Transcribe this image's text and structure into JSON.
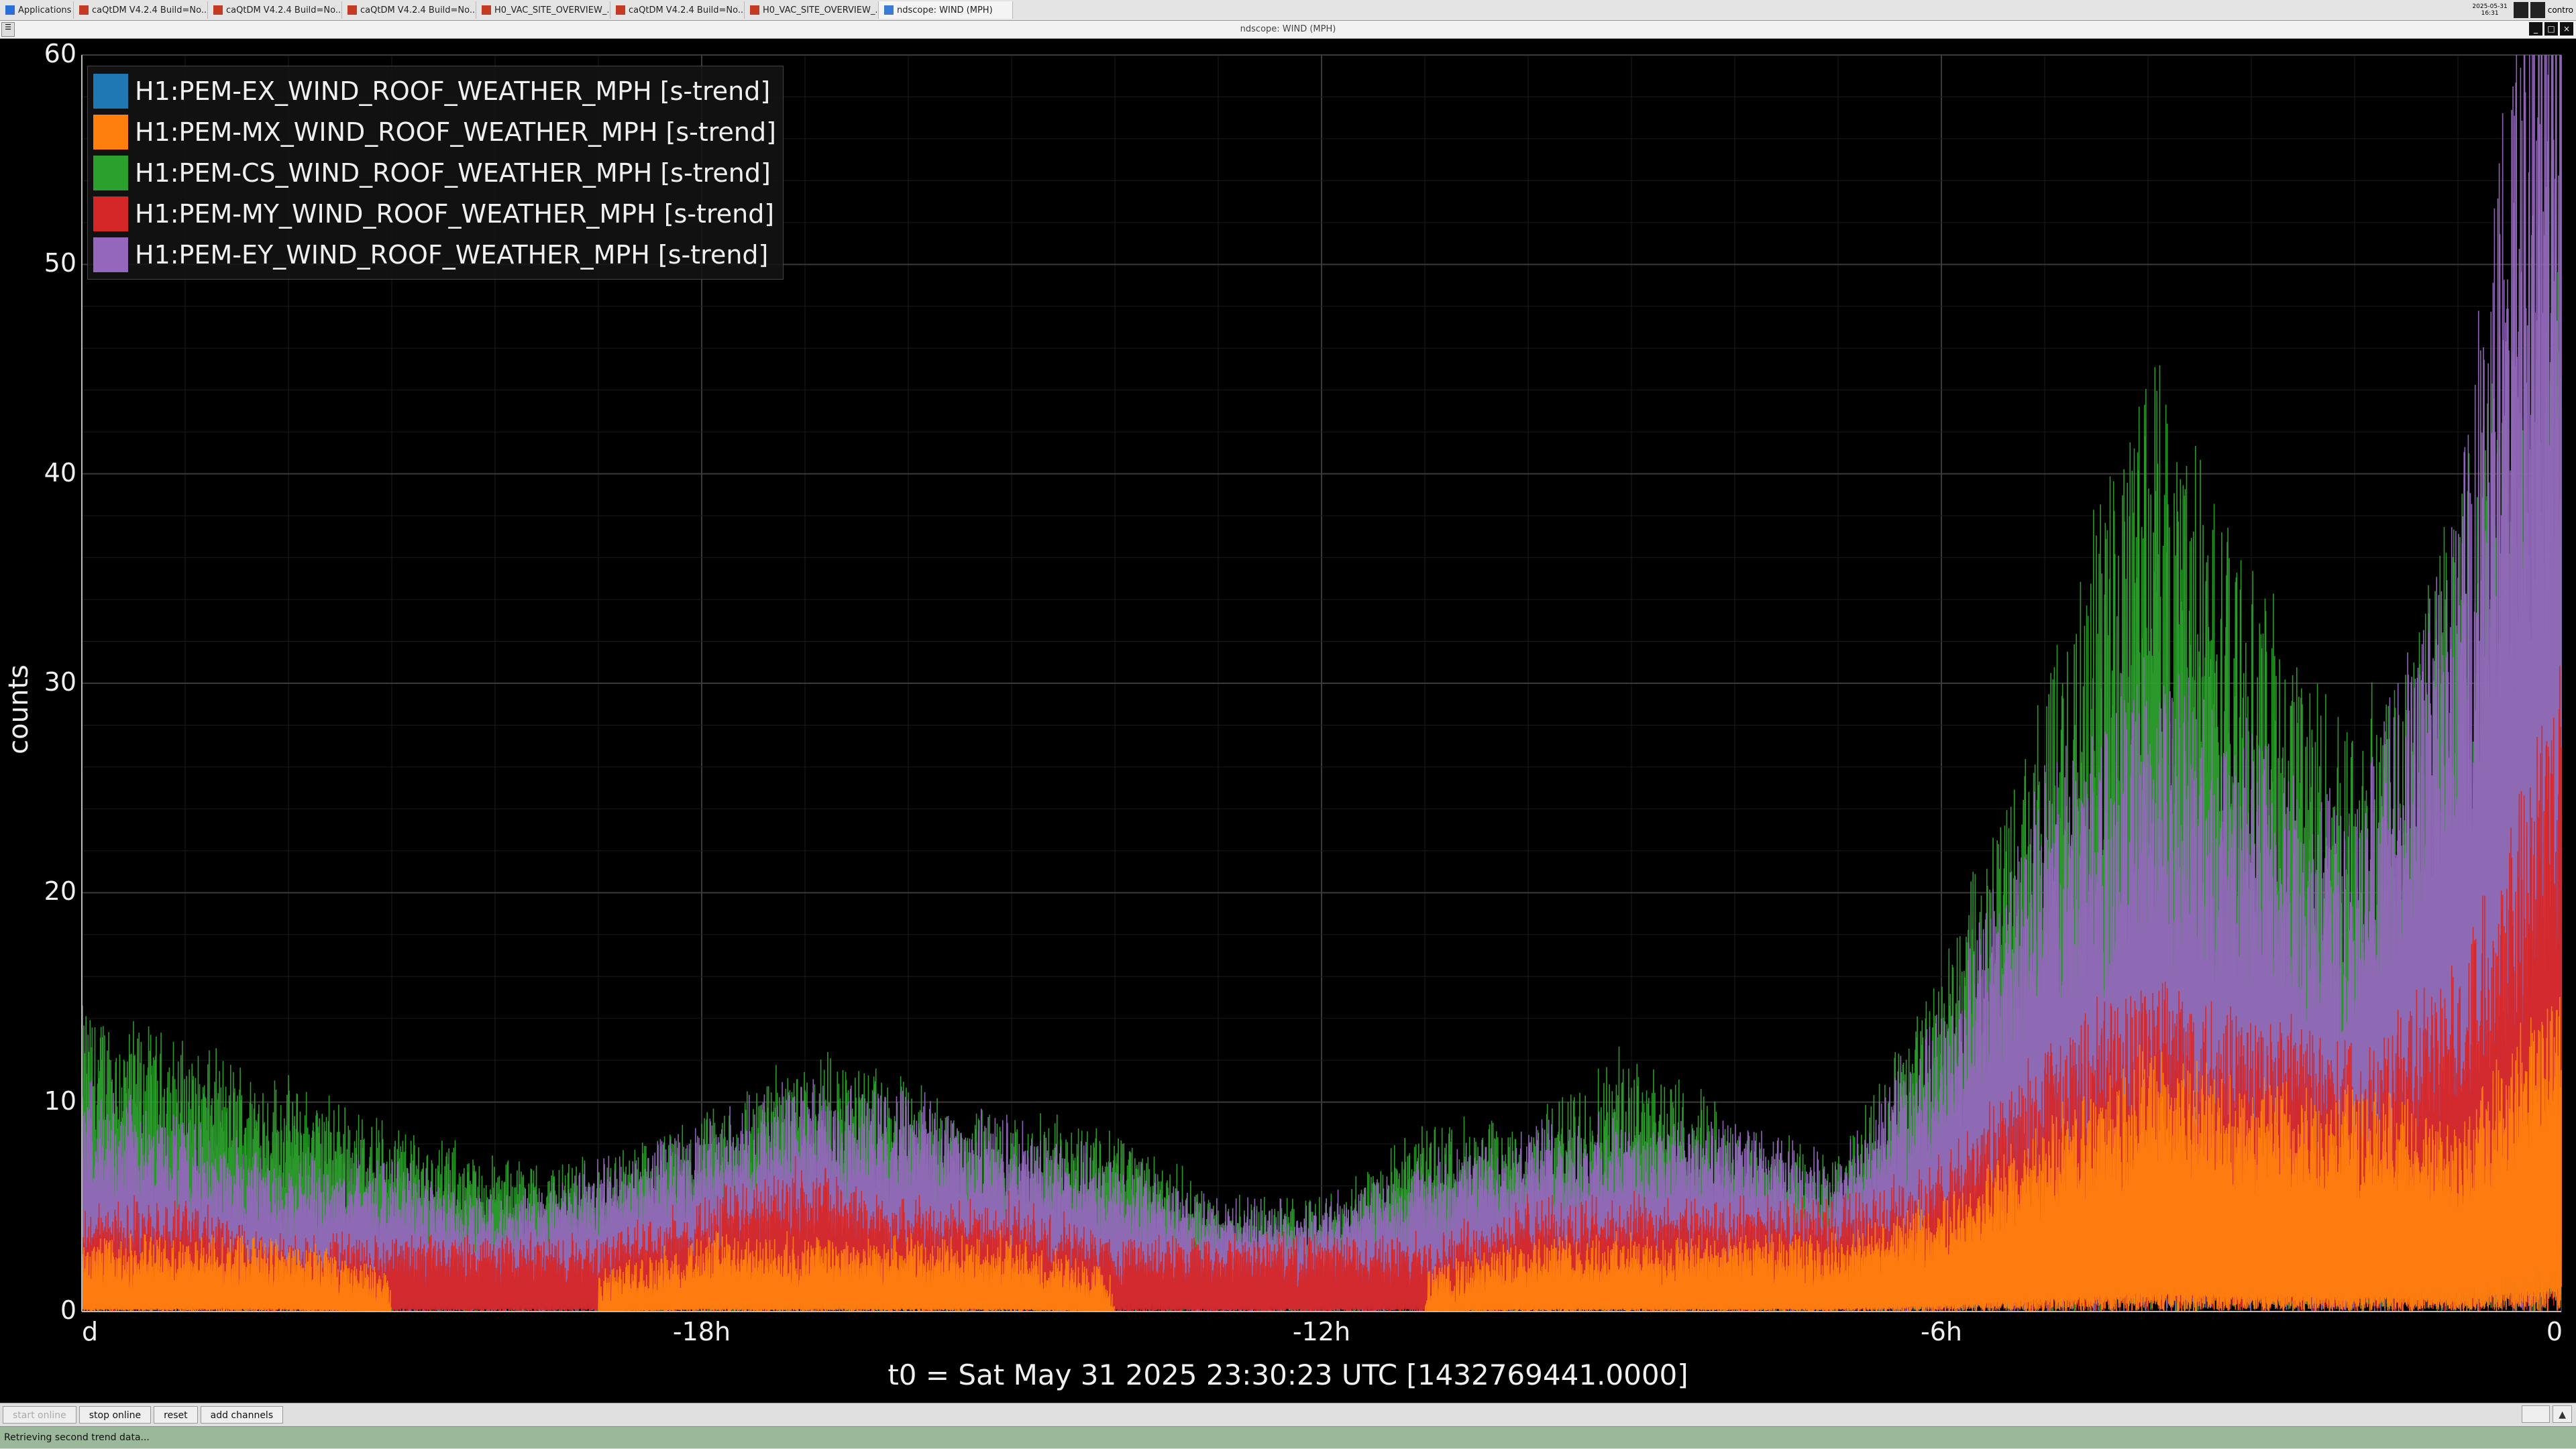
{
  "taskbar": {
    "tasks": [
      {
        "label": "Applications",
        "icon": "app-menu-icon"
      },
      {
        "label": "caQtDM V4.2.4 Build=No...",
        "icon": "caqtdm-icon"
      },
      {
        "label": "caQtDM V4.2.4 Build=No...",
        "icon": "caqtdm-icon"
      },
      {
        "label": "caQtDM V4.2.4 Build=No...",
        "icon": "caqtdm-icon"
      },
      {
        "label": "H0_VAC_SITE_OVERVIEW_...",
        "icon": "caqtdm-icon"
      },
      {
        "label": "caQtDM V4.2.4 Build=No...",
        "icon": "caqtdm-icon"
      },
      {
        "label": "H0_VAC_SITE_OVERVIEW_...",
        "icon": "caqtdm-icon"
      },
      {
        "label": "ndscope: WIND (MPH)",
        "icon": "ndscope-icon"
      }
    ],
    "clock_date": "2025-05-31",
    "clock_time": "16:31",
    "tray_text": "contro"
  },
  "window": {
    "title": "ndscope: WIND (MPH)"
  },
  "legend": [
    {
      "label": "H1:PEM-EX_WIND_ROOF_WEATHER_MPH [s-trend]",
      "color": "#1f77b4"
    },
    {
      "label": "H1:PEM-MX_WIND_ROOF_WEATHER_MPH [s-trend]",
      "color": "#ff7f0e"
    },
    {
      "label": "H1:PEM-CS_WIND_ROOF_WEATHER_MPH [s-trend]",
      "color": "#2ca02c"
    },
    {
      "label": "H1:PEM-MY_WIND_ROOF_WEATHER_MPH [s-trend]",
      "color": "#d62728"
    },
    {
      "label": "H1:PEM-EY_WIND_ROOF_WEATHER_MPH [s-trend]",
      "color": "#9467bd"
    }
  ],
  "chart_data": {
    "type": "line",
    "ylabel": "counts",
    "ylim": [
      0,
      60
    ],
    "yticks": [
      "0",
      "10",
      "20",
      "30",
      "40",
      "50",
      "60"
    ],
    "xlim_hours": [
      -24,
      0
    ],
    "xticks": [
      {
        "value": -24,
        "label": "d"
      },
      {
        "value": -18,
        "label": "-18h"
      },
      {
        "value": -12,
        "label": "-12h"
      },
      {
        "value": -6,
        "label": "-6h"
      },
      {
        "value": 0,
        "label": "0"
      }
    ],
    "xlabel": "t0 = Sat May 31 2025 23:30:23 UTC [1432769441.0000]",
    "grid": true,
    "series": [
      {
        "name": "H1:PEM-CS_WIND_ROOF_WEATHER_MPH [s-trend]",
        "color": "#2ca02c",
        "x": [
          -24,
          -23,
          -22,
          -21,
          -20,
          -19,
          -18,
          -17,
          -16,
          -15,
          -14,
          -13,
          -12,
          -11,
          -10,
          -9,
          -8,
          -7,
          -6,
          -5,
          -4,
          -3,
          -2,
          -1,
          0
        ],
        "y": [
          7,
          6,
          5,
          4,
          3,
          3,
          4,
          6,
          5,
          4,
          4,
          2,
          2,
          4,
          4,
          6,
          4,
          3,
          8,
          15,
          24,
          18,
          14,
          20,
          30
        ]
      },
      {
        "name": "H1:PEM-EY_WIND_ROOF_WEATHER_MPH [s-trend]",
        "color": "#9467bd",
        "x": [
          -24,
          -23,
          -22,
          -21,
          -20,
          -19,
          -18,
          -17,
          -16,
          -15,
          -14,
          -13,
          -12,
          -11,
          -10,
          -9,
          -8,
          -7,
          -6,
          -5,
          -4,
          -3,
          -2,
          -1,
          0
        ],
        "y": [
          5,
          4,
          3,
          3,
          2,
          3,
          4,
          5,
          5,
          4,
          3,
          2,
          2,
          3,
          4,
          4,
          4,
          3,
          7,
          13,
          16,
          14,
          12,
          20,
          42
        ]
      },
      {
        "name": "H1:PEM-MY_WIND_ROOF_WEATHER_MPH [s-trend]",
        "color": "#d62728",
        "x": [
          -24,
          -23,
          -22,
          -21,
          -20,
          -19,
          -18,
          -17,
          -16,
          -15,
          -14,
          -13,
          -12,
          -11,
          -10,
          -9,
          -8,
          -7,
          -6,
          -5,
          -4,
          -3,
          -2,
          -1,
          0
        ],
        "y": [
          2,
          2,
          1,
          1,
          1,
          1,
          2,
          3,
          2,
          2,
          1,
          1,
          1,
          1,
          2,
          2,
          2,
          2,
          3,
          6,
          8,
          7,
          6,
          8,
          16
        ]
      },
      {
        "name": "H1:PEM-MX_WIND_ROOF_WEATHER_MPH [s-trend]",
        "color": "#ff7f0e",
        "x": [
          -24,
          -23,
          -22,
          -21,
          -20,
          -19,
          -18,
          -17,
          -16,
          -15,
          -14,
          -13,
          -12,
          -11,
          -10,
          -9,
          -8,
          -7,
          -6,
          -5,
          -4,
          -3,
          -2,
          -1,
          0
        ],
        "y": [
          1,
          1,
          1,
          0,
          0,
          0,
          1,
          1,
          1,
          1,
          0,
          0,
          0,
          0,
          1,
          1,
          1,
          1,
          2,
          4,
          6,
          5,
          5,
          4,
          8
        ]
      },
      {
        "name": "H1:PEM-EX_WIND_ROOF_WEATHER_MPH [s-trend]",
        "color": "#1f77b4",
        "x": [
          -24,
          -12,
          0
        ],
        "y": [
          0,
          0,
          0
        ]
      }
    ]
  },
  "buttons": {
    "start_online": "start online",
    "stop_online": "stop online",
    "reset": "reset",
    "add_channels": "add channels"
  },
  "status": {
    "message": "Retrieving second trend data..."
  }
}
